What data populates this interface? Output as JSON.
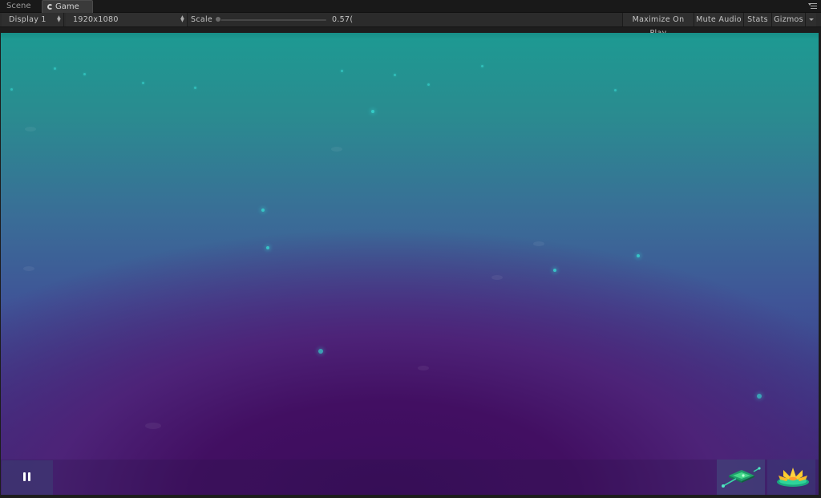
{
  "tabs": [
    {
      "label": "Scene",
      "active": false
    },
    {
      "label": "Game",
      "active": true,
      "icon": "pacman-icon"
    }
  ],
  "toolbar": {
    "display": "Display 1",
    "resolution": "1920x1080",
    "scale_label": "Scale",
    "scale_value": "0.57(",
    "maximize_label": "Maximize On Play",
    "mute_label": "Mute Audio",
    "stats_label": "Stats",
    "gizmos_label": "Gizmos"
  },
  "game": {
    "colors": {
      "top": "#1d9a92",
      "middle": "#3f5597",
      "bottom": "#3b0d5c",
      "particle": "#37d6d0"
    },
    "hud": {
      "pause_icon": "pause-icon",
      "tools": [
        "tile-tool-icon",
        "lotus-icon"
      ]
    }
  }
}
